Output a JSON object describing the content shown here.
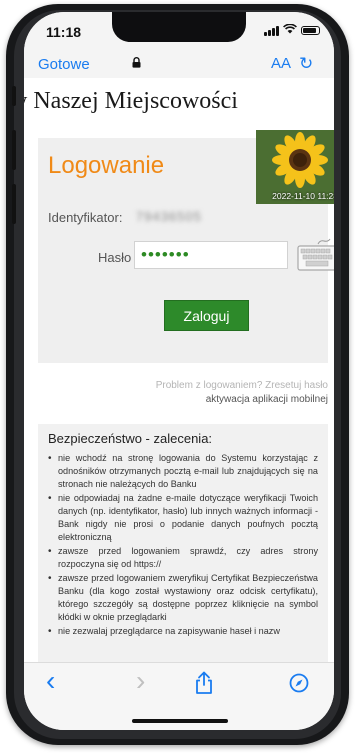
{
  "status_bar": {
    "time": "11:18"
  },
  "toolbar": {
    "done_label": "Gotowe",
    "text_size_label": "AA",
    "lock_icon": "lock-icon",
    "reload_icon": "reload-icon"
  },
  "page": {
    "title": "w Naszej Miejscowości"
  },
  "login": {
    "heading": "Logowanie",
    "photo_date": "2022-11-10 11:28",
    "id_label": "Identyfikator:",
    "id_value": "79436505",
    "password_label": "Hasło",
    "password_value": "•••••••",
    "submit_label": "Zaloguj",
    "problem_text": "Problem z logowaniem? Zresetuj hasło",
    "activation_text": "aktywacja aplikacji mobilnej"
  },
  "security": {
    "title": "Bezpieczeństwo - zalecenia:",
    "items": [
      "nie wchodź na stronę logowania do Systemu korzystając z odnośników otrzymanych pocztą e-mail lub znajdujących się na stronach nie należących do Banku",
      "nie odpowiadaj na żadne e-maile dotyczące weryfikacji Twoich danych (np. identyfikator, hasło) lub innych ważnych informacji - Bank nigdy nie prosi o podanie danych poufnych pocztą elektroniczną",
      "zawsze przed logowaniem sprawdź, czy adres strony rozpoczyna się od https://",
      "zawsze przed logowaniem zweryfikuj Certyfikat Bezpieczeństwa Banku (dla kogo został wystawiony oraz odcisk certyfikatu), którego szczegóły są dostępne poprzez kliknięcie na symbol kłódki w oknie przeglądarki",
      "nie zezwalaj przeglądarce na zapisywanie haseł i nazw"
    ]
  },
  "bottom_bar": {
    "back": "‹",
    "forward": "›",
    "share_icon": "share-icon",
    "compass_icon": "compass-icon"
  },
  "colors": {
    "accent": "#1a7cf0",
    "login_heading": "#f08a17",
    "login_button": "#2d8a2a"
  }
}
